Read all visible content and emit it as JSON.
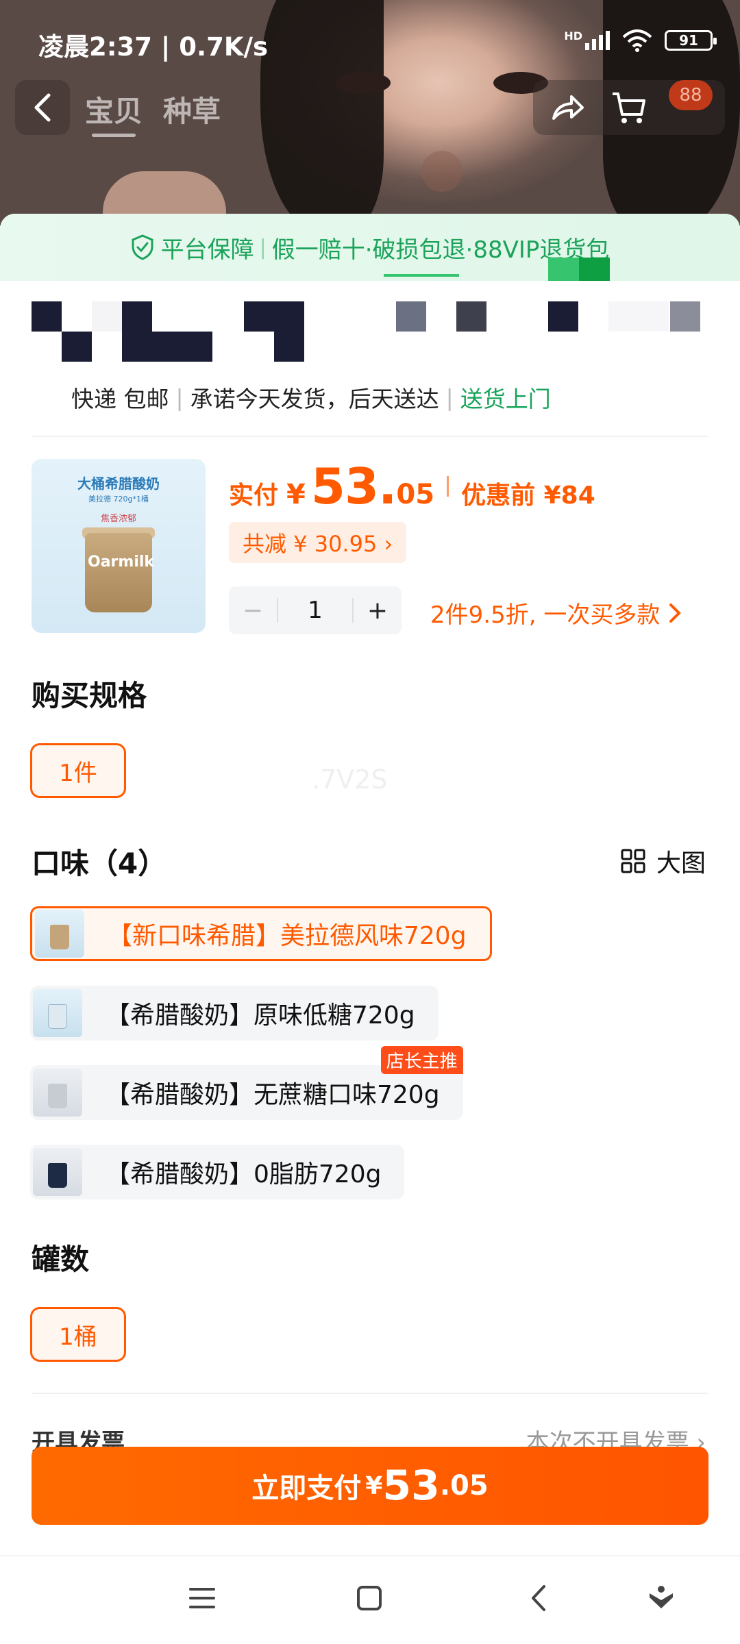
{
  "status": {
    "time": "凌晨2:37 | 0.7K/s",
    "hd": "HD",
    "battery": "91"
  },
  "nav": {
    "tabs": [
      "宝贝",
      "种草"
    ],
    "cart_badge": "88"
  },
  "guarantee": {
    "label": "平台保障",
    "items": "假一赔十·破损包退·88VIP退货包"
  },
  "delivery": {
    "shipping": "快递 包邮",
    "promise": "承诺今天发货，后天送达",
    "home": "送货上门"
  },
  "product": {
    "thumb_title": "大桶希腊酸奶",
    "thumb_sub": "美拉德 720g*1桶",
    "thumb_tag": "焦香浓郁",
    "thumb_brand": "Oarmilk",
    "pay_label": "实付",
    "yen": "¥",
    "price_int": "53.",
    "price_dec": "05",
    "orig_price": "优惠前 ¥84",
    "reduce": "共减 ¥ 30.95 ›",
    "qty": "1",
    "qty_minus": "−",
    "qty_plus": "+",
    "promo": "2件9.5折, 一次买多款"
  },
  "spec": {
    "title": "购买规格",
    "option": "1件"
  },
  "flavor": {
    "title": "口味（4）",
    "bigview": "大图",
    "options": [
      "【新口味希腊】美拉德风味720g",
      "【希腊酸奶】原味低糖720g",
      "【希腊酸奶】无蔗糖口味720g",
      "【希腊酸奶】0脂肪720g"
    ],
    "tag": "店长主推"
  },
  "ghost_text": ".7V2S",
  "cans": {
    "title": "罐数",
    "option": "1桶"
  },
  "peek": {
    "left": "开具发票",
    "right": "本次不开具发票 ›"
  },
  "pay_button": {
    "label": "立即支付",
    "yen": "¥",
    "big": "53",
    "small": ".05"
  },
  "colors": {
    "accent": "#ff5a00",
    "green": "#17a45a"
  }
}
